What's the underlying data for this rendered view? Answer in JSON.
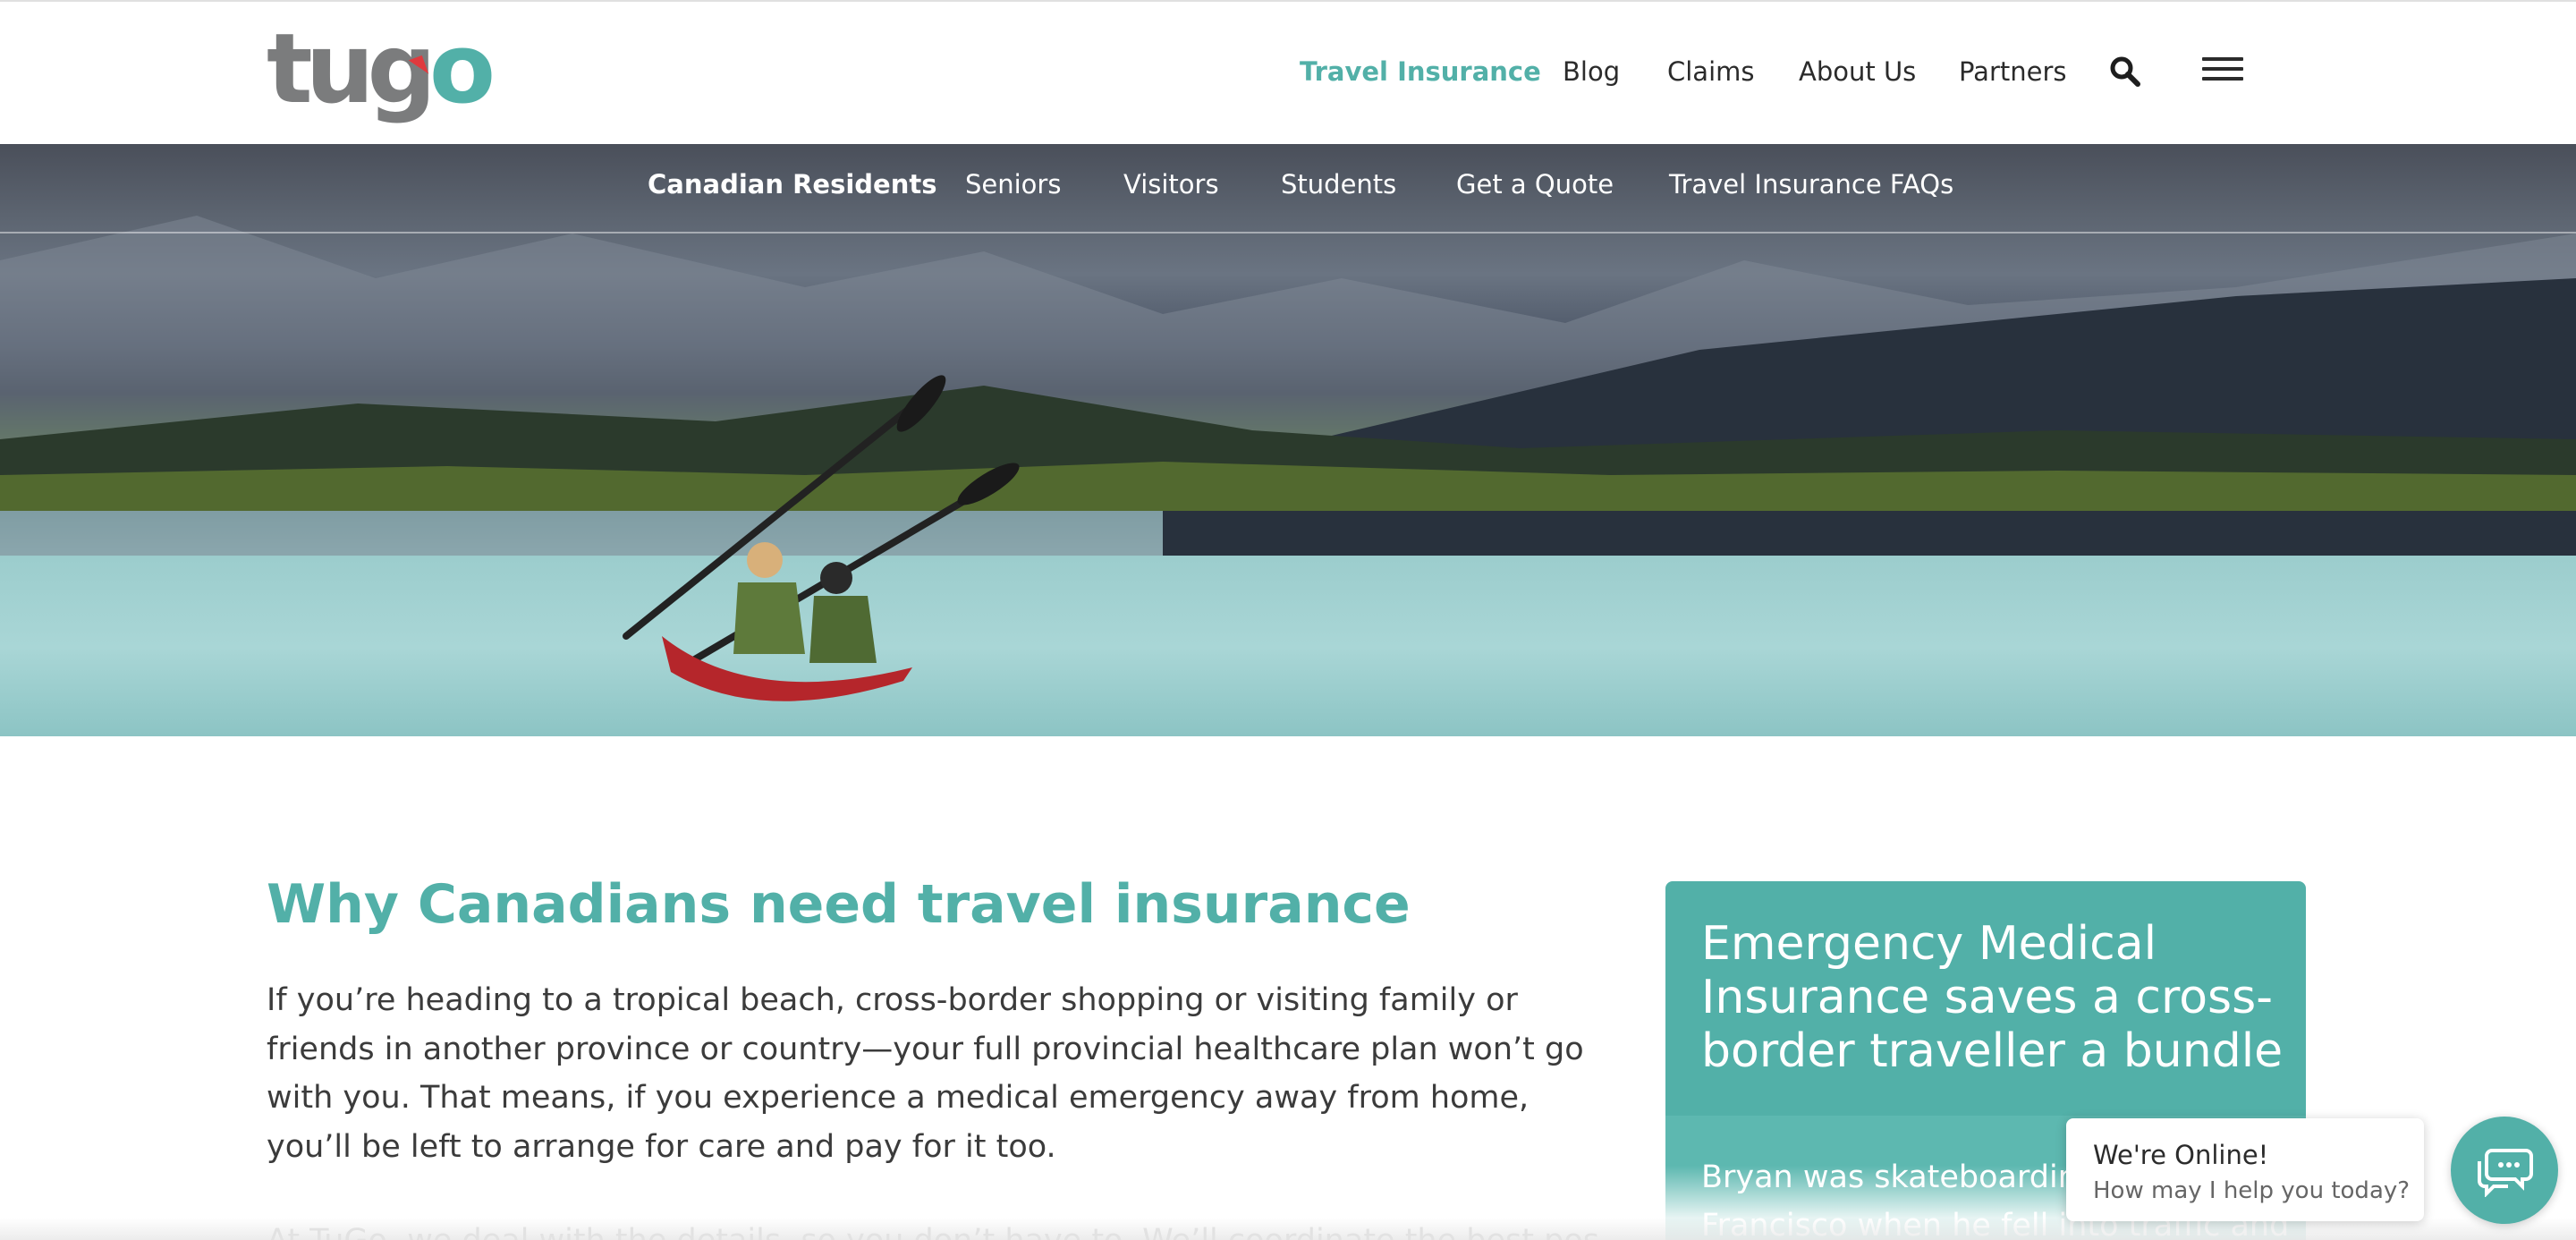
{
  "brand": {
    "logo_text": "tugo",
    "colors": {
      "accent": "#52b0a8",
      "text": "#3b3b3b",
      "logo_grey": "#7b7c7d",
      "logo_flag": "#e03a3e"
    }
  },
  "mainnav": {
    "items": [
      {
        "label": "Travel Insurance",
        "active": true
      },
      {
        "label": "Blog"
      },
      {
        "label": "Claims"
      },
      {
        "label": "About Us"
      },
      {
        "label": "Partners"
      }
    ],
    "search_icon": "search-icon",
    "menu_icon": "hamburger-menu-icon"
  },
  "subnav": {
    "items": [
      {
        "label": "Canadian Residents",
        "active": true
      },
      {
        "label": "Seniors"
      },
      {
        "label": "Visitors"
      },
      {
        "label": "Students"
      },
      {
        "label": "Get a Quote"
      },
      {
        "label": "Travel Insurance FAQs"
      }
    ]
  },
  "main": {
    "heading": "Why Canadians need travel insurance",
    "paragraph1": "If you’re heading to a tropical beach, cross-border shopping or visiting family or friends in another province or country—your full provincial healthcare plan won’t go with you. That means, if you experience a medical emergency away from home, you’ll be left to arrange for care and pay for it too.",
    "paragraph2": "At TuGo, we deal with the details, so you don’t have to. We’ll coordinate the best possible"
  },
  "card": {
    "title": "Emergency Medical Insurance saves a cross-border traveller a bundle",
    "body": "Bryan was skateboarding in San Francisco when he fell into traffic and"
  },
  "chat": {
    "title": "We're Online!",
    "subtitle": "How may I help you today?",
    "icon": "chat-icon"
  }
}
